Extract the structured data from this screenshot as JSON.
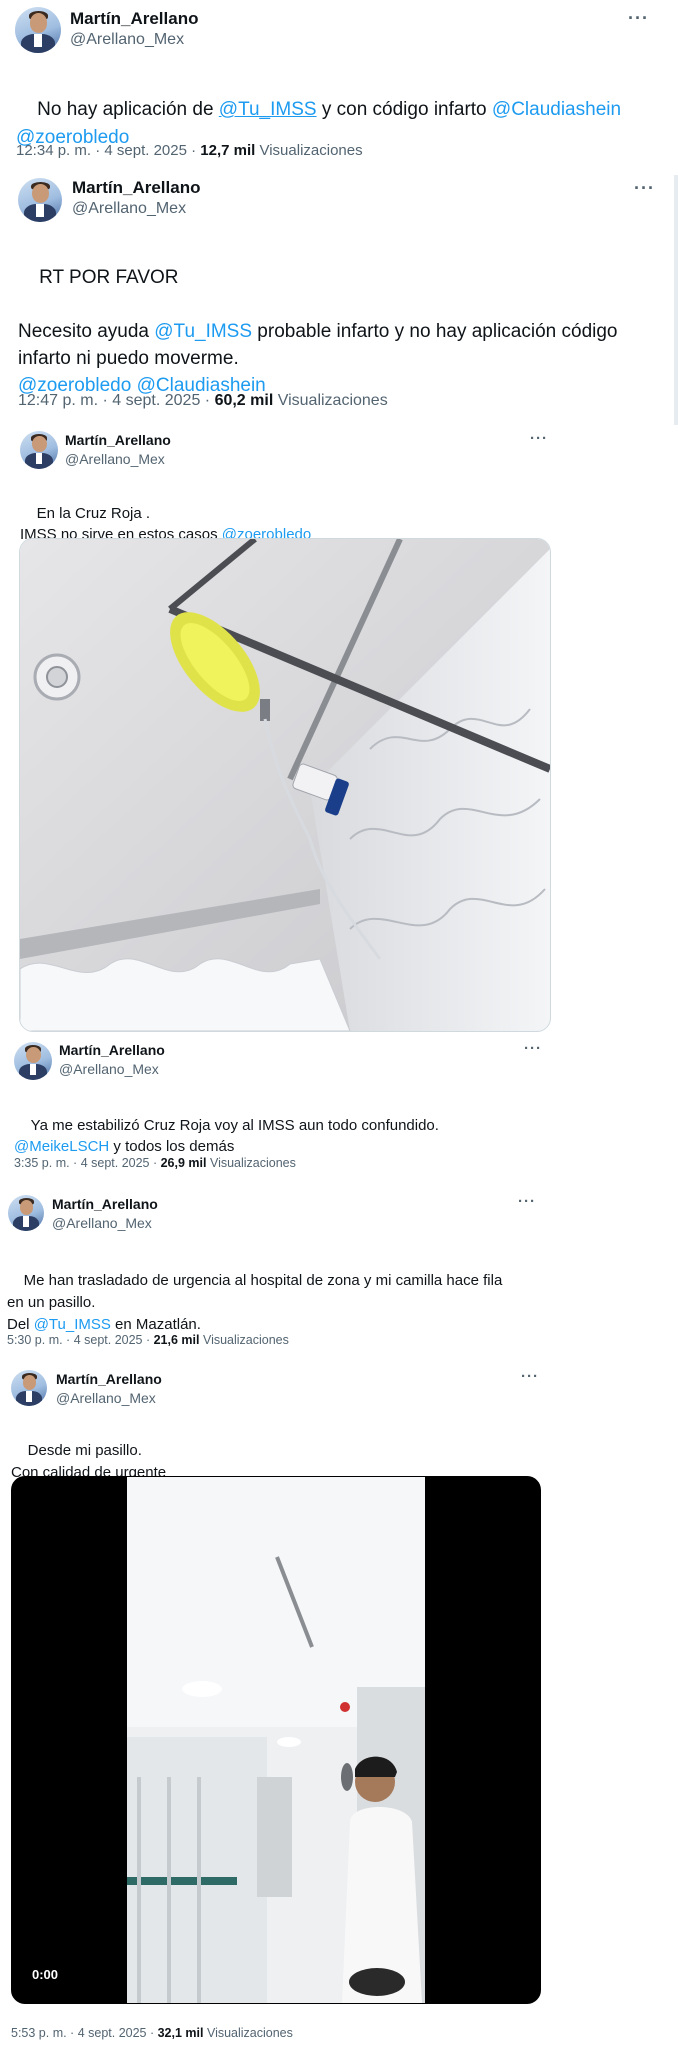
{
  "tweets": [
    {
      "author": "Martín_Arellano",
      "handle": "@Arellano_Mex",
      "text_parts": [
        {
          "t": "No hay aplicación de ",
          "m": false
        },
        {
          "t": "@Tu_IMSS",
          "m": true
        },
        {
          "t": " y con código infarto ",
          "m": false
        },
        {
          "t": "@Claudiashein",
          "m": true
        },
        {
          "t": "\n",
          "m": false
        },
        {
          "t": "@zoerobledo",
          "m": true
        }
      ],
      "time": "12:34 p. m. · 4 sept. 2025 · ",
      "views_count": "12,7 mil",
      "views_label": " Visualizaciones"
    },
    {
      "author": "Martín_Arellano",
      "handle": "@Arellano_Mex",
      "text_parts": [
        {
          "t": "RT POR FAVOR\n\nNecesito ayuda ",
          "m": false
        },
        {
          "t": "@Tu_IMSS",
          "m": true
        },
        {
          "t": " probable infarto y no hay aplicación código\ninfarto ni puedo moverme.\n",
          "m": false
        },
        {
          "t": "@zoerobledo",
          "m": true
        },
        {
          "t": " ",
          "m": false
        },
        {
          "t": "@Claudiashein",
          "m": true
        }
      ],
      "time": "12:47 p. m. · 4 sept. 2025 · ",
      "views_count": "60,2 mil",
      "views_label": " Visualizaciones"
    },
    {
      "author": "Martín_Arellano",
      "handle": "@Arellano_Mex",
      "text_parts": [
        {
          "t": "En la Cruz Roja .\nIMSS no sirve en estos casos ",
          "m": false
        },
        {
          "t": "@zoerobledo",
          "m": true
        }
      ]
    },
    {
      "author": "Martín_Arellano",
      "handle": "@Arellano_Mex",
      "text_parts": [
        {
          "t": "Ya me estabilizó Cruz Roja voy al IMSS aun todo confundido.\n",
          "m": false
        },
        {
          "t": "@MeikeLSCH",
          "m": true
        },
        {
          "t": " y todos los demás",
          "m": false
        }
      ],
      "time": "3:35 p. m. · 4 sept. 2025 · ",
      "views_count": "26,9 mil",
      "views_label": " Visualizaciones"
    },
    {
      "author": "Martín_Arellano",
      "handle": "@Arellano_Mex",
      "text_parts": [
        {
          "t": "Me han trasladado de urgencia al hospital de zona y mi camilla hace fila\nen un pasillo.\nDel ",
          "m": false
        },
        {
          "t": "@Tu_IMSS",
          "m": true
        },
        {
          "t": " en Mazatlán.",
          "m": false
        }
      ],
      "time": "5:30 p. m. · 4 sept. 2025 · ",
      "views_count": "21,6 mil",
      "views_label": " Visualizaciones"
    },
    {
      "author": "Martín_Arellano",
      "handle": "@Arellano_Mex",
      "text_parts": [
        {
          "t": "Desde mi pasillo.\nCon calidad de urgente",
          "m": false
        }
      ],
      "video_time": "0:00",
      "time": "5:53 p. m. · 4 sept. 2025 · ",
      "views_count": "32,1 mil",
      "views_label": " Visualizaciones"
    }
  ],
  "more_glyph": "···",
  "colors": {
    "mention": "#1d9bf0",
    "muted": "#536471",
    "text": "#0f1419"
  }
}
